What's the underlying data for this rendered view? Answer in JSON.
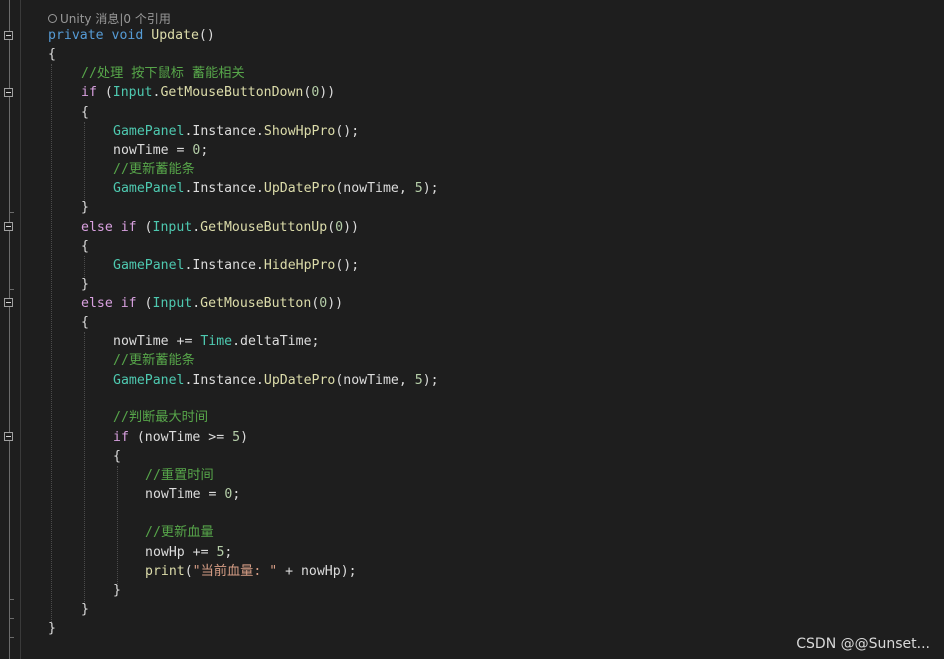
{
  "codelens": {
    "text": "Unity 消息|0 个引用"
  },
  "lines": {
    "l2": {
      "kw1": "private",
      "kw2": "void",
      "fn": "Update",
      "rest": "()"
    },
    "l3": "{",
    "l4": "//处理 按下鼠标 蓄能相关",
    "l5": {
      "kw": "if",
      "p1": " (",
      "type": "Input",
      "dot": ".",
      "fn": "GetMouseButtonDown",
      "p2": "(",
      "num": "0",
      "p3": "))"
    },
    "l6": "{",
    "l7": {
      "type": "GamePanel",
      "mid": ".Instance.",
      "fn": "ShowHpPro",
      "rest": "();"
    },
    "l8": {
      "pre": "nowTime = ",
      "num": "0",
      "rest": ";"
    },
    "l9": "//更新蓄能条",
    "l10": {
      "type": "GamePanel",
      "mid": ".Instance.",
      "fn": "UpDatePro",
      "p1": "(nowTime, ",
      "num": "5",
      "rest": ");"
    },
    "l11": "}",
    "l12": {
      "kw1": "else",
      "kw2": "if",
      "p1": " (",
      "type": "Input",
      "dot": ".",
      "fn": "GetMouseButtonUp",
      "p2": "(",
      "num": "0",
      "p3": "))"
    },
    "l13": "{",
    "l14": {
      "type": "GamePanel",
      "mid": ".Instance.",
      "fn": "HideHpPro",
      "rest": "();"
    },
    "l15": "}",
    "l16": {
      "kw1": "else",
      "kw2": "if",
      "p1": " (",
      "type": "Input",
      "dot": ".",
      "fn": "GetMouseButton",
      "p2": "(",
      "num": "0",
      "p3": "))"
    },
    "l17": "{",
    "l18": {
      "pre": "nowTime += ",
      "type": "Time",
      "rest": ".deltaTime;"
    },
    "l19": "//更新蓄能条",
    "l20": {
      "type": "GamePanel",
      "mid": ".Instance.",
      "fn": "UpDatePro",
      "p1": "(nowTime, ",
      "num": "5",
      "rest": ");"
    },
    "l22": "//判断最大时间",
    "l23": {
      "kw": "if",
      "p1": " (nowTime >= ",
      "num": "5",
      "rest": ")"
    },
    "l24": "{",
    "l25": "//重置时间",
    "l26": {
      "pre": "nowTime = ",
      "num": "0",
      "rest": ";"
    },
    "l28": "//更新血量",
    "l29": {
      "pre": "nowHp += ",
      "num": "5",
      "rest": ";"
    },
    "l30": {
      "fn": "print",
      "p1": "(",
      "str": "\"当前血量: \"",
      "rest": " + nowHp);"
    },
    "l31": "}",
    "l32": "}",
    "l33": "}"
  },
  "watermark": "CSDN @@Sunset..."
}
